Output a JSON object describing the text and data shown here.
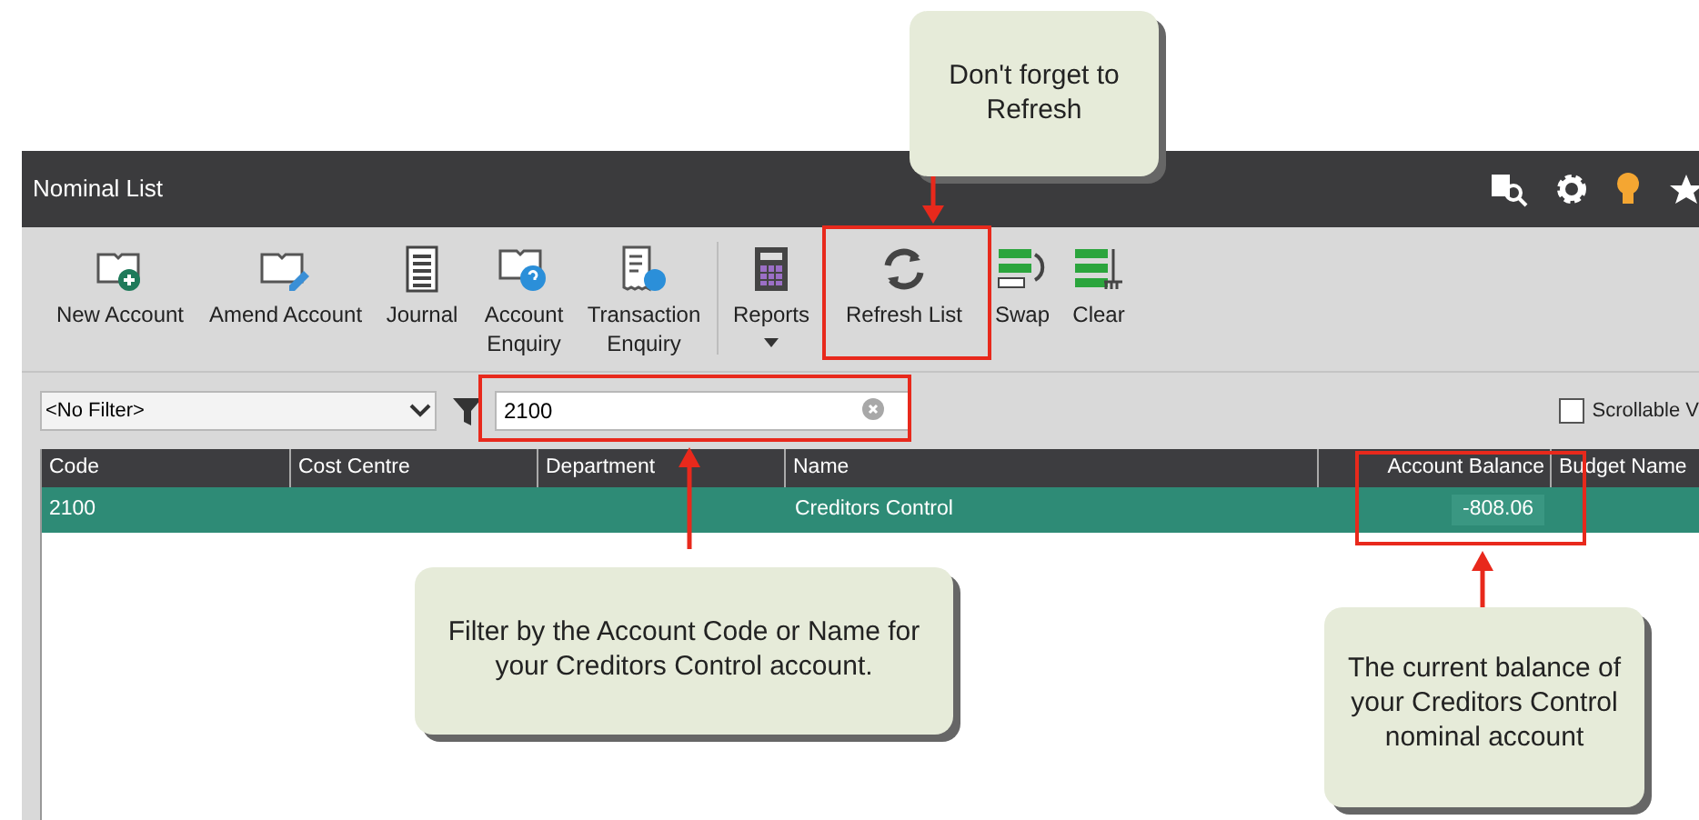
{
  "window": {
    "title": "Nominal List"
  },
  "toolbar": [
    {
      "label": "New Account"
    },
    {
      "label": "Amend Account"
    },
    {
      "label": "Journal"
    },
    {
      "label": "Account Enquiry"
    },
    {
      "label": "Transaction Enquiry"
    },
    {
      "label": "Reports",
      "has_menu": true
    },
    {
      "label": "Refresh List"
    },
    {
      "label": "Swap"
    },
    {
      "label": "Clear"
    }
  ],
  "filter": {
    "selected": "<No Filter>",
    "search_value": "2100",
    "scrollable_checkbox": {
      "label": "Scrollable V",
      "checked": false
    }
  },
  "table": {
    "columns": [
      "Code",
      "Cost Centre",
      "Department",
      "Name",
      "Account Balance",
      "Budget Name"
    ],
    "rows": [
      {
        "selected": true,
        "cells": [
          "2100",
          "",
          "",
          "Creditors Control",
          "-808.06",
          ""
        ]
      }
    ]
  },
  "callouts": [
    {
      "text": "Don't forget to Refresh"
    },
    {
      "text": "Filter by the Account Code or Name for your Creditors Control account."
    },
    {
      "text": "The current balance of your Creditors Control nominal account"
    }
  ]
}
